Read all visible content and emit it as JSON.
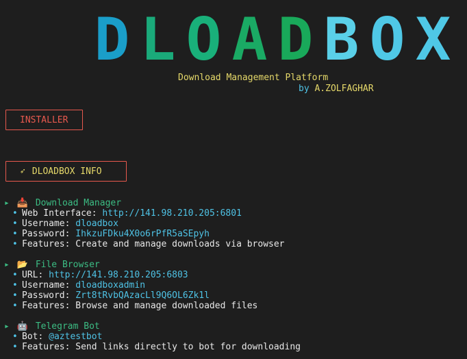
{
  "logo": {
    "letters": [
      {
        "ch": "D",
        "color": "#1a9ec9"
      },
      {
        "ch": "L",
        "color": "#1aaa7a"
      },
      {
        "ch": "O",
        "color": "#19b07a"
      },
      {
        "ch": "A",
        "color": "#1aaa64"
      },
      {
        "ch": "D",
        "color": "#19a95a"
      },
      {
        "ch": "B",
        "color": "#5ad0e8"
      },
      {
        "ch": "O",
        "color": "#4fc8e6"
      },
      {
        "ch": "X",
        "color": "#4fc8e6"
      }
    ]
  },
  "subtitle": "Download Management Platform",
  "byline": {
    "by": "by",
    "author": "A.ZOLFAGHAR"
  },
  "buttons": {
    "installer": "INSTALLER",
    "info": "DLOADBOX INFO",
    "info_icon": "rocket-icon"
  },
  "sections": [
    {
      "icon": "download-icon",
      "glyph": "📥",
      "title": "Download Manager",
      "items": [
        {
          "label": "Web Interface: ",
          "value": "http://141.98.210.205:6801"
        },
        {
          "label": "Username: ",
          "value": "dloadbox"
        },
        {
          "label": "Password: ",
          "value": "IhkzuFDku4X0o6rPfR5aSEpyh"
        },
        {
          "label": "Features: Create and manage downloads via browser",
          "value": ""
        }
      ]
    },
    {
      "icon": "folder-icon",
      "glyph": "📂",
      "title": "File Browser",
      "items": [
        {
          "label": "URL: ",
          "value": "http://141.98.210.205:6803"
        },
        {
          "label": "Username: ",
          "value": "dloadboxadmin"
        },
        {
          "label": "Password: ",
          "value": "Zrt8tRvbQAzacLl9Q6OL6Zk1l"
        },
        {
          "label": "Features: Browse and manage downloaded files",
          "value": ""
        }
      ]
    },
    {
      "icon": "robot-icon",
      "glyph": "🤖",
      "title": "Telegram Bot",
      "items": [
        {
          "label": "Bot: ",
          "value": "@aztestbot"
        },
        {
          "label": "Features: Send links directly to bot for downloading",
          "value": ""
        }
      ]
    }
  ]
}
